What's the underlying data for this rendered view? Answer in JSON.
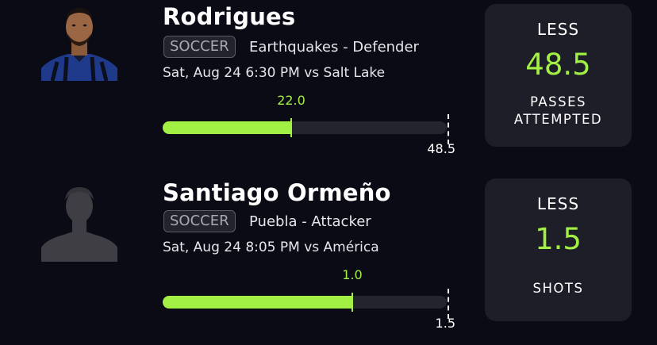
{
  "colors": {
    "background": "#0a0b14",
    "accent": "#a3f045",
    "panel": "#1d1e27",
    "track": "#23242e"
  },
  "players": [
    {
      "name": "Rodrigues",
      "avatar": "player-photo",
      "sport": "SOCCER",
      "team_position": "Earthquakes - Defender",
      "game": "Sat, Aug 24 6:30 PM  vs Salt Lake",
      "current_value": "22.0",
      "line_value": "48.5",
      "progress_fraction": 0.4536,
      "pick": {
        "direction": "LESS",
        "line": "48.5",
        "stat": "PASSES ATTEMPTED"
      }
    },
    {
      "name": "Santiago Ormeño",
      "avatar": "silhouette-placeholder",
      "sport": "SOCCER",
      "team_position": "Puebla - Attacker",
      "game": "Sat, Aug 24 8:05 PM  vs América",
      "current_value": "1.0",
      "line_value": "1.5",
      "progress_fraction": 0.6667,
      "pick": {
        "direction": "LESS",
        "line": "1.5",
        "stat": "SHOTS"
      }
    }
  ]
}
